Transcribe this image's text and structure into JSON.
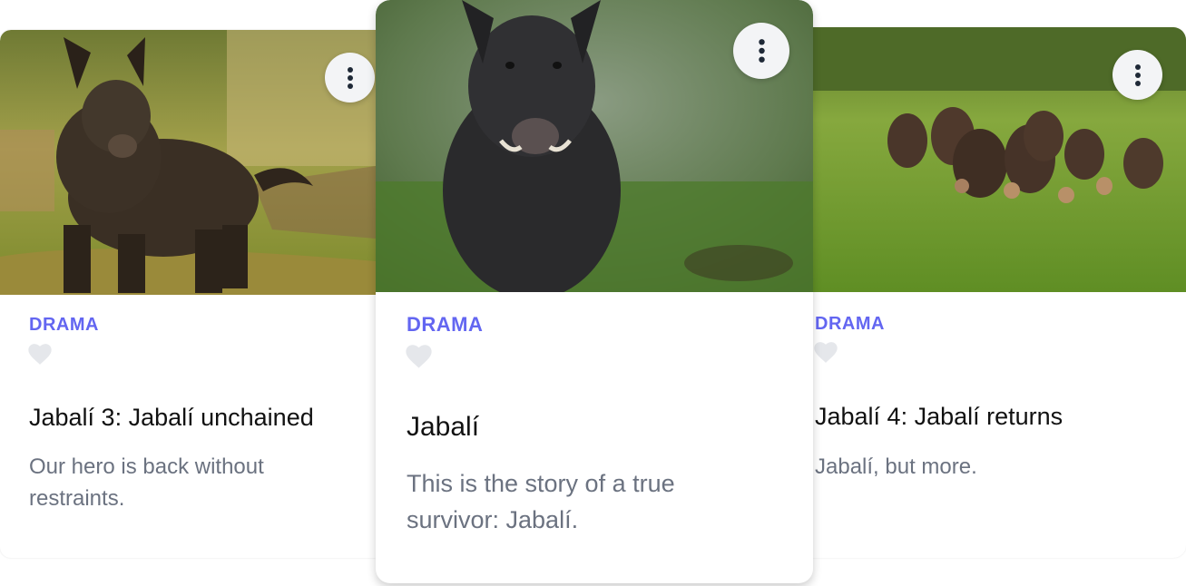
{
  "cards": [
    {
      "genre": "DRAMA",
      "title": "Jabalí 3: Jabalí unchained",
      "description": "Our hero is back without restraints.",
      "image_subject": "single wild boar standing on grassy ground",
      "favorited": false,
      "menu_icon": "vertical-dots-icon"
    },
    {
      "genre": "DRAMA",
      "title": "Jabalí",
      "description": "This is the story of a true survivor: Jabalí.",
      "image_subject": "dark wild boar facing the camera in green grass",
      "favorited": false,
      "menu_icon": "vertical-dots-icon"
    },
    {
      "genre": "DRAMA",
      "title": "Jabalí 4: Jabalí returns",
      "description": "Jabalí, but more.",
      "image_subject": "herd of wild boars with piglets running across a meadow",
      "favorited": false,
      "menu_icon": "vertical-dots-icon"
    }
  ],
  "colors": {
    "genre_accent": "#6366f1",
    "heart_inactive": "#e5e7eb",
    "description_text": "#6b7280",
    "menu_button_bg": "#f3f4f6"
  }
}
